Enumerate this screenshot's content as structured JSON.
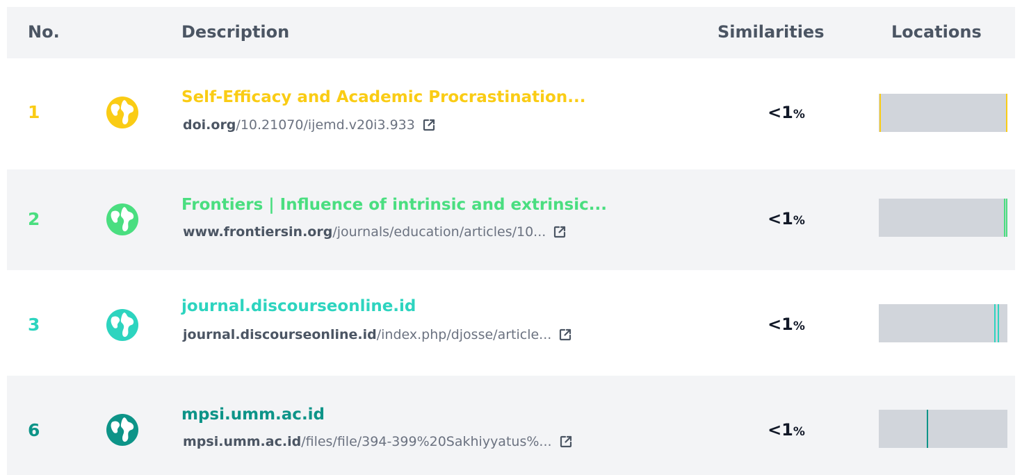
{
  "header": {
    "no": "No.",
    "description": "Description",
    "similarities": "Similarities",
    "locations": "Locations"
  },
  "rows": [
    {
      "number": "1",
      "title": "Self-Efficacy and Academic Procrastination...",
      "url_domain": "doi.org",
      "url_path": "/10.21070/ijemd.v20i3.933",
      "similarity_value": "<1",
      "similarity_unit": "%",
      "color": "#facc15",
      "icon": "globe-icon",
      "location_marks": [
        0.005,
        0.99
      ]
    },
    {
      "number": "2",
      "title": "Frontiers | Influence of intrinsic and extrinsic...",
      "url_domain": "www.frontiersin.org",
      "url_path": "/journals/education/articles/10...",
      "similarity_value": "<1",
      "similarity_unit": "%",
      "color": "#4ade80",
      "icon": "globe-icon",
      "location_marks": [
        0.975,
        0.99
      ]
    },
    {
      "number": "3",
      "title": "journal.discourseonline.id",
      "url_domain": "journal.discourseonline.id",
      "url_path": "/index.php/djosse/article...",
      "similarity_value": "<1",
      "similarity_unit": "%",
      "color": "#2dd4bf",
      "icon": "globe-icon",
      "location_marks": [
        0.895,
        0.925
      ]
    },
    {
      "number": "6",
      "title": "mpsi.umm.ac.id",
      "url_domain": "mpsi.umm.ac.id",
      "url_path": "/files/file/394-399%20Sakhiyyatus%...",
      "similarity_value": "<1",
      "similarity_unit": "%",
      "color": "#0d9488",
      "icon": "globe-icon",
      "location_marks": [
        0.375
      ]
    }
  ]
}
